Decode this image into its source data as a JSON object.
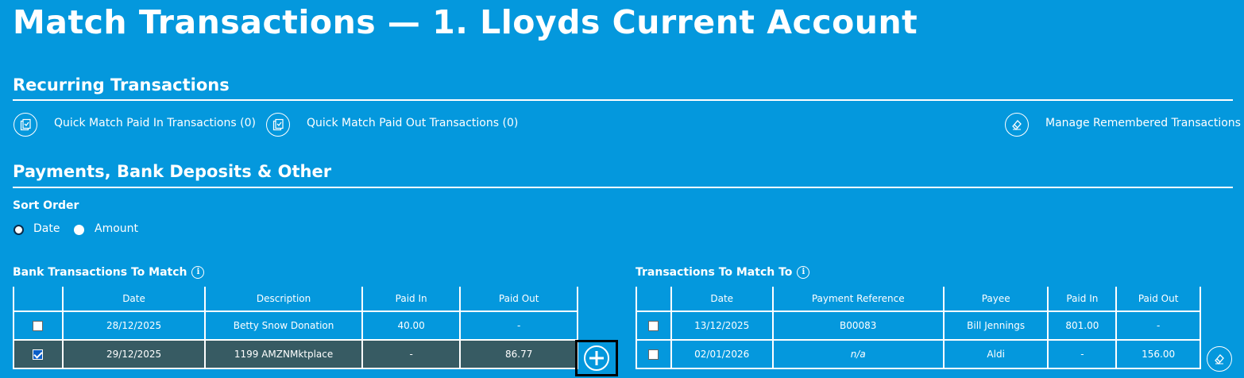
{
  "page": {
    "title": "Match Transactions — 1. Lloyds Current Account"
  },
  "recurring": {
    "heading": "Recurring Transactions",
    "quick_in_label": "Quick Match Paid In Transactions (0)",
    "quick_out_label": "Quick Match Paid Out Transactions (0)",
    "manage_label": "Manage Remembered Transactions"
  },
  "payments": {
    "heading": "Payments, Bank Deposits & Other",
    "sort_label": "Sort Order",
    "sort_options": [
      "Date",
      "Amount"
    ],
    "sort_selected": "Date"
  },
  "bank_table": {
    "title": "Bank Transactions To Match",
    "headers": [
      "",
      "Date",
      "Description",
      "Paid In",
      "Paid Out"
    ],
    "rows": [
      {
        "checked": false,
        "date": "28/12/2025",
        "description": "Betty Snow Donation",
        "paid_in": "40.00",
        "paid_out": "-"
      },
      {
        "checked": true,
        "date": "29/12/2025",
        "description": "1199 AMZNMktplace",
        "paid_in": "-",
        "paid_out": "86.77"
      }
    ]
  },
  "match_table": {
    "title": "Transactions To Match To",
    "headers": [
      "",
      "Date",
      "Payment Reference",
      "Payee",
      "Paid In",
      "Paid Out"
    ],
    "rows": [
      {
        "checked": false,
        "date": "13/12/2025",
        "reference": "B00083",
        "payee": "Bill Jennings",
        "paid_in": "801.00",
        "paid_out": "-"
      },
      {
        "checked": false,
        "date": "02/01/2026",
        "reference": "n/a",
        "payee": "Aldi",
        "paid_in": "-",
        "paid_out": "156.00"
      }
    ]
  },
  "colors": {
    "background": "#0498dd",
    "selected_row": "#375b63"
  }
}
